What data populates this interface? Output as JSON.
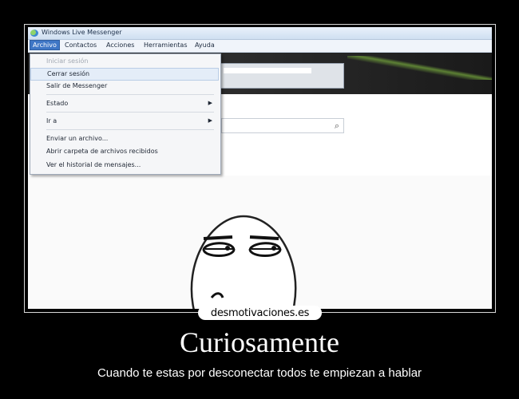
{
  "window": {
    "title": "Windows Live Messenger",
    "app_icon": "messenger-icon"
  },
  "menubar": {
    "items": [
      {
        "label": "Archivo",
        "active": true
      },
      {
        "label": "Contactos"
      },
      {
        "label": "Acciones"
      },
      {
        "label": "Herramientas"
      },
      {
        "label": "Ayuda"
      }
    ]
  },
  "dropdown": {
    "items": [
      {
        "label": "Iniciar sesión",
        "disabled": true
      },
      {
        "label": "Cerrar sesión",
        "highlighted": true
      },
      {
        "label": "Salir de Messenger"
      },
      {
        "label": "Estado",
        "submenu": true
      },
      {
        "label": "Ir a",
        "submenu": true
      },
      {
        "label": "Enviar un archivo..."
      },
      {
        "label": "Abrir carpeta de archivos recibidos"
      },
      {
        "label": "Ver el historial de mensajes..."
      }
    ],
    "submenu_icon": "chevron-right-icon"
  },
  "search": {
    "placeholder": "",
    "icon": "search-icon"
  },
  "watermark": "desmotivaciones.es",
  "caption": {
    "title": "Curiosamente",
    "subtitle": "Cuando te estas por desconectar todos te empiezan a hablar"
  },
  "colors": {
    "menu_active": "#3f77c6",
    "background": "#000000",
    "caption_text": "#ffffff"
  }
}
